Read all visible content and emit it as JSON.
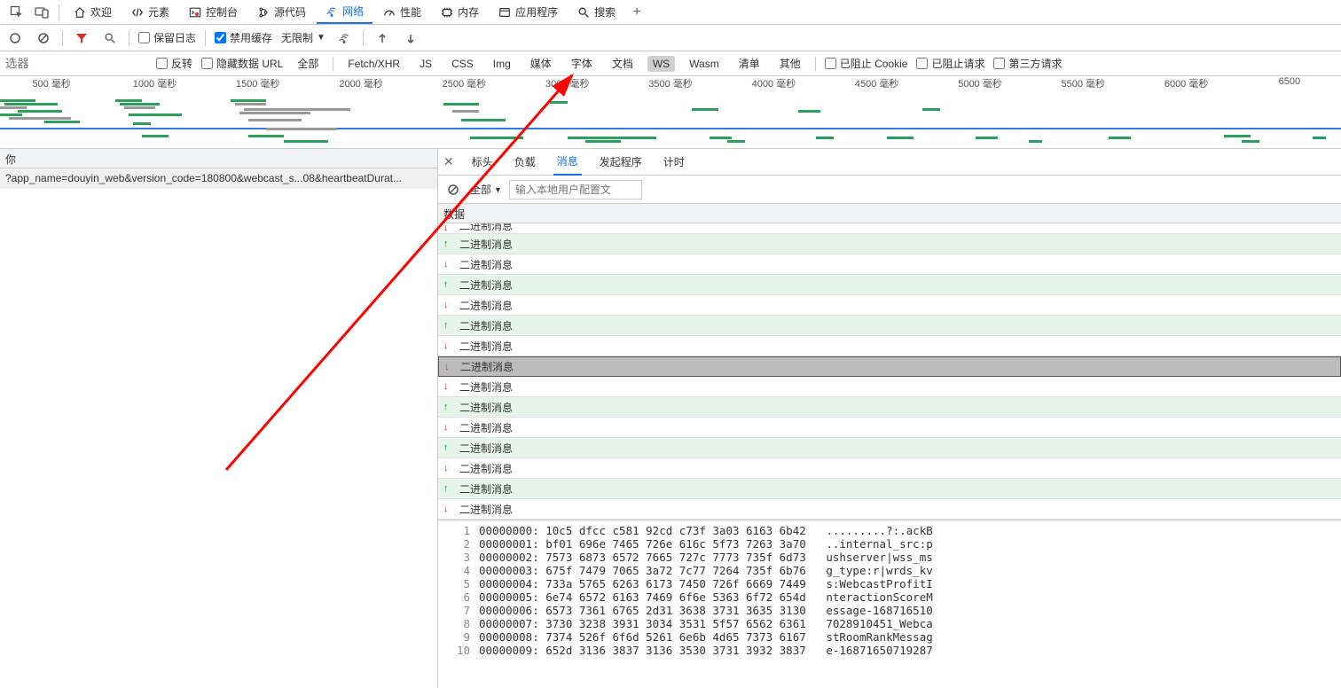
{
  "topTabs": {
    "welcome": "欢迎",
    "elements": "元素",
    "console": "控制台",
    "sources": "源代码",
    "network": "网络",
    "performance": "性能",
    "memory": "内存",
    "application": "应用程序",
    "search": "搜索"
  },
  "toolbar": {
    "preserveLog": "保留日志",
    "disableCache": "禁用缓存",
    "throttling": "无限制"
  },
  "filterBar": {
    "placeholder": "选器",
    "invert": "反转",
    "hideDataUrls": "隐藏数据 URL",
    "types": {
      "all": "全部",
      "fetchxhr": "Fetch/XHR",
      "js": "JS",
      "css": "CSS",
      "img": "Img",
      "media": "媒体",
      "font": "字体",
      "doc": "文档",
      "ws": "WS",
      "wasm": "Wasm",
      "manifest": "清单",
      "other": "其他"
    },
    "blockedCookies": "已阻止 Cookie",
    "blockedRequests": "已阻止请求",
    "thirdParty": "第三方请求"
  },
  "timeline": {
    "ticks": [
      "500 毫秒",
      "1000 毫秒",
      "1500 毫秒",
      "2000 毫秒",
      "2500 毫秒",
      "3000 毫秒",
      "3500 毫秒",
      "4000 毫秒",
      "4500 毫秒",
      "5000 毫秒",
      "5500 毫秒",
      "6000 毫秒",
      "6500"
    ]
  },
  "requests": {
    "nameHeader": "你",
    "items": [
      "?app_name=douyin_web&version_code=180800&webcast_s...08&heartbeatDurat..."
    ]
  },
  "detailTabs": {
    "headers": "标头",
    "payload": "负载",
    "messages": "消息",
    "initiator": "发起程序",
    "timing": "计时"
  },
  "msgToolbar": {
    "all": "全部",
    "filterPlaceholder": "输入本地用户配置文"
  },
  "dataHeader": "数据",
  "binaryLabel": "二进制消息",
  "msgs": [
    {
      "dir": "down",
      "sel": false,
      "topcut": true
    },
    {
      "dir": "up",
      "sel": false
    },
    {
      "dir": "down",
      "sel": false
    },
    {
      "dir": "up",
      "sel": false
    },
    {
      "dir": "down",
      "sel": false
    },
    {
      "dir": "up",
      "sel": false
    },
    {
      "dir": "down",
      "sel": false
    },
    {
      "dir": "down",
      "sel": true
    },
    {
      "dir": "down",
      "sel": false
    },
    {
      "dir": "up",
      "sel": false
    },
    {
      "dir": "down",
      "sel": false
    },
    {
      "dir": "up",
      "sel": false
    },
    {
      "dir": "down",
      "sel": false
    },
    {
      "dir": "up",
      "sel": false
    },
    {
      "dir": "down",
      "sel": false
    }
  ],
  "hex": [
    {
      "n": "1",
      "off": "00000000:",
      "b": "10c5 dfcc c581 92cd c73f 3a03 6163 6b42",
      "a": ".........?:.ackB"
    },
    {
      "n": "2",
      "off": "00000001:",
      "b": "bf01 696e 7465 726e 616c 5f73 7263 3a70",
      "a": "..internal_src:p"
    },
    {
      "n": "3",
      "off": "00000002:",
      "b": "7573 6873 6572 7665 727c 7773 735f 6d73",
      "a": "ushserver|wss_ms"
    },
    {
      "n": "4",
      "off": "00000003:",
      "b": "675f 7479 7065 3a72 7c77 7264 735f 6b76",
      "a": "g_type:r|wrds_kv"
    },
    {
      "n": "5",
      "off": "00000004:",
      "b": "733a 5765 6263 6173 7450 726f 6669 7449",
      "a": "s:WebcastProfitI"
    },
    {
      "n": "6",
      "off": "00000005:",
      "b": "6e74 6572 6163 7469 6f6e 5363 6f72 654d",
      "a": "nteractionScoreM"
    },
    {
      "n": "7",
      "off": "00000006:",
      "b": "6573 7361 6765 2d31 3638 3731 3635 3130",
      "a": "essage-168716510"
    },
    {
      "n": "8",
      "off": "00000007:",
      "b": "3730 3238 3931 3034 3531 5f57 6562 6361",
      "a": "7028910451_Webca"
    },
    {
      "n": "9",
      "off": "00000008:",
      "b": "7374 526f 6f6d 5261 6e6b 4d65 7373 6167",
      "a": "stRoomRankMessag"
    },
    {
      "n": "10",
      "off": "00000009:",
      "b": "652d 3136 3837 3136 3530 3731 3932 3837",
      "a": "e-16871650719287"
    }
  ]
}
